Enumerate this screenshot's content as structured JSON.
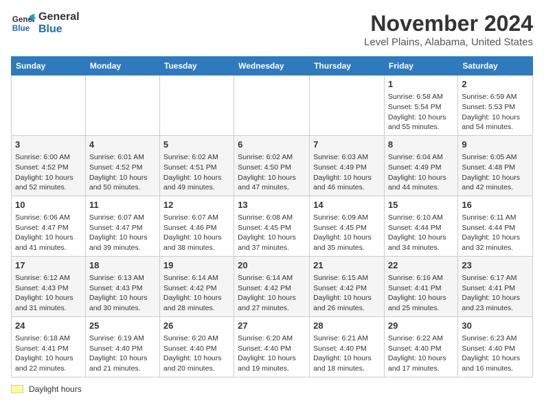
{
  "logo": {
    "line1": "General",
    "line2": "Blue"
  },
  "title": "November 2024",
  "location": "Level Plains, Alabama, United States",
  "headers": [
    "Sunday",
    "Monday",
    "Tuesday",
    "Wednesday",
    "Thursday",
    "Friday",
    "Saturday"
  ],
  "legend": {
    "label": "Daylight hours"
  },
  "weeks": [
    [
      {
        "day": "",
        "info": ""
      },
      {
        "day": "",
        "info": ""
      },
      {
        "day": "",
        "info": ""
      },
      {
        "day": "",
        "info": ""
      },
      {
        "day": "",
        "info": ""
      },
      {
        "day": "1",
        "info": "Sunrise: 6:58 AM\nSunset: 5:54 PM\nDaylight: 10 hours and 55 minutes."
      },
      {
        "day": "2",
        "info": "Sunrise: 6:59 AM\nSunset: 5:53 PM\nDaylight: 10 hours and 54 minutes."
      }
    ],
    [
      {
        "day": "3",
        "info": "Sunrise: 6:00 AM\nSunset: 4:52 PM\nDaylight: 10 hours and 52 minutes."
      },
      {
        "day": "4",
        "info": "Sunrise: 6:01 AM\nSunset: 4:52 PM\nDaylight: 10 hours and 50 minutes."
      },
      {
        "day": "5",
        "info": "Sunrise: 6:02 AM\nSunset: 4:51 PM\nDaylight: 10 hours and 49 minutes."
      },
      {
        "day": "6",
        "info": "Sunrise: 6:02 AM\nSunset: 4:50 PM\nDaylight: 10 hours and 47 minutes."
      },
      {
        "day": "7",
        "info": "Sunrise: 6:03 AM\nSunset: 4:49 PM\nDaylight: 10 hours and 46 minutes."
      },
      {
        "day": "8",
        "info": "Sunrise: 6:04 AM\nSunset: 4:49 PM\nDaylight: 10 hours and 44 minutes."
      },
      {
        "day": "9",
        "info": "Sunrise: 6:05 AM\nSunset: 4:48 PM\nDaylight: 10 hours and 42 minutes."
      }
    ],
    [
      {
        "day": "10",
        "info": "Sunrise: 6:06 AM\nSunset: 4:47 PM\nDaylight: 10 hours and 41 minutes."
      },
      {
        "day": "11",
        "info": "Sunrise: 6:07 AM\nSunset: 4:47 PM\nDaylight: 10 hours and 39 minutes."
      },
      {
        "day": "12",
        "info": "Sunrise: 6:07 AM\nSunset: 4:46 PM\nDaylight: 10 hours and 38 minutes."
      },
      {
        "day": "13",
        "info": "Sunrise: 6:08 AM\nSunset: 4:45 PM\nDaylight: 10 hours and 37 minutes."
      },
      {
        "day": "14",
        "info": "Sunrise: 6:09 AM\nSunset: 4:45 PM\nDaylight: 10 hours and 35 minutes."
      },
      {
        "day": "15",
        "info": "Sunrise: 6:10 AM\nSunset: 4:44 PM\nDaylight: 10 hours and 34 minutes."
      },
      {
        "day": "16",
        "info": "Sunrise: 6:11 AM\nSunset: 4:44 PM\nDaylight: 10 hours and 32 minutes."
      }
    ],
    [
      {
        "day": "17",
        "info": "Sunrise: 6:12 AM\nSunset: 4:43 PM\nDaylight: 10 hours and 31 minutes."
      },
      {
        "day": "18",
        "info": "Sunrise: 6:13 AM\nSunset: 4:43 PM\nDaylight: 10 hours and 30 minutes."
      },
      {
        "day": "19",
        "info": "Sunrise: 6:14 AM\nSunset: 4:42 PM\nDaylight: 10 hours and 28 minutes."
      },
      {
        "day": "20",
        "info": "Sunrise: 6:14 AM\nSunset: 4:42 PM\nDaylight: 10 hours and 27 minutes."
      },
      {
        "day": "21",
        "info": "Sunrise: 6:15 AM\nSunset: 4:42 PM\nDaylight: 10 hours and 26 minutes."
      },
      {
        "day": "22",
        "info": "Sunrise: 6:16 AM\nSunset: 4:41 PM\nDaylight: 10 hours and 25 minutes."
      },
      {
        "day": "23",
        "info": "Sunrise: 6:17 AM\nSunset: 4:41 PM\nDaylight: 10 hours and 23 minutes."
      }
    ],
    [
      {
        "day": "24",
        "info": "Sunrise: 6:18 AM\nSunset: 4:41 PM\nDaylight: 10 hours and 22 minutes."
      },
      {
        "day": "25",
        "info": "Sunrise: 6:19 AM\nSunset: 4:40 PM\nDaylight: 10 hours and 21 minutes."
      },
      {
        "day": "26",
        "info": "Sunrise: 6:20 AM\nSunset: 4:40 PM\nDaylight: 10 hours and 20 minutes."
      },
      {
        "day": "27",
        "info": "Sunrise: 6:20 AM\nSunset: 4:40 PM\nDaylight: 10 hours and 19 minutes."
      },
      {
        "day": "28",
        "info": "Sunrise: 6:21 AM\nSunset: 4:40 PM\nDaylight: 10 hours and 18 minutes."
      },
      {
        "day": "29",
        "info": "Sunrise: 6:22 AM\nSunset: 4:40 PM\nDaylight: 10 hours and 17 minutes."
      },
      {
        "day": "30",
        "info": "Sunrise: 6:23 AM\nSunset: 4:40 PM\nDaylight: 10 hours and 16 minutes."
      }
    ]
  ]
}
